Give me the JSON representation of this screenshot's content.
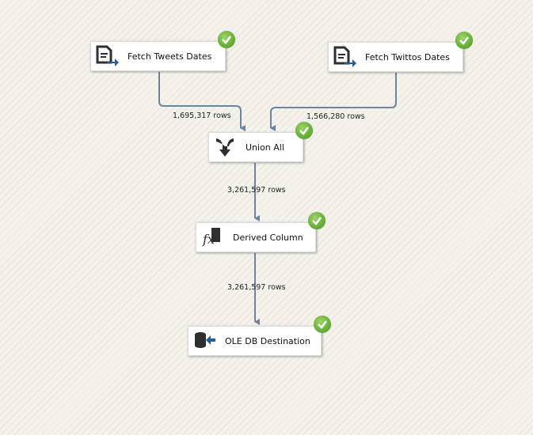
{
  "tasks": [
    {
      "id": "fetch-tweets-dates",
      "label": "Fetch Tweets Dates",
      "icon": "source-file-icon",
      "status": "success"
    },
    {
      "id": "fetch-twittos-dates",
      "label": "Fetch Twittos Dates",
      "icon": "source-file-icon",
      "status": "success"
    },
    {
      "id": "union-all",
      "label": "Union All",
      "icon": "union-all-icon",
      "status": "success"
    },
    {
      "id": "derived-column",
      "label": "Derived Column",
      "icon": "derived-column-icon",
      "status": "success"
    },
    {
      "id": "ole-db-destination",
      "label": "OLE DB Destination",
      "icon": "ole-db-destination-icon",
      "status": "success"
    }
  ],
  "paths": [
    {
      "from": "fetch-tweets-dates",
      "to": "union-all",
      "rows": "1,695,317 rows"
    },
    {
      "from": "fetch-twittos-dates",
      "to": "union-all",
      "rows": "1,566,280 rows"
    },
    {
      "from": "union-all",
      "to": "derived-column",
      "rows": "3,261,597 rows"
    },
    {
      "from": "derived-column",
      "to": "ole-db-destination",
      "rows": "3,261,597 rows"
    }
  ],
  "colors": {
    "path": "#6b84a3",
    "success": "#6ab23a",
    "icon_dark": "#2f2f2f",
    "icon_arrow": "#1e5f9e"
  }
}
